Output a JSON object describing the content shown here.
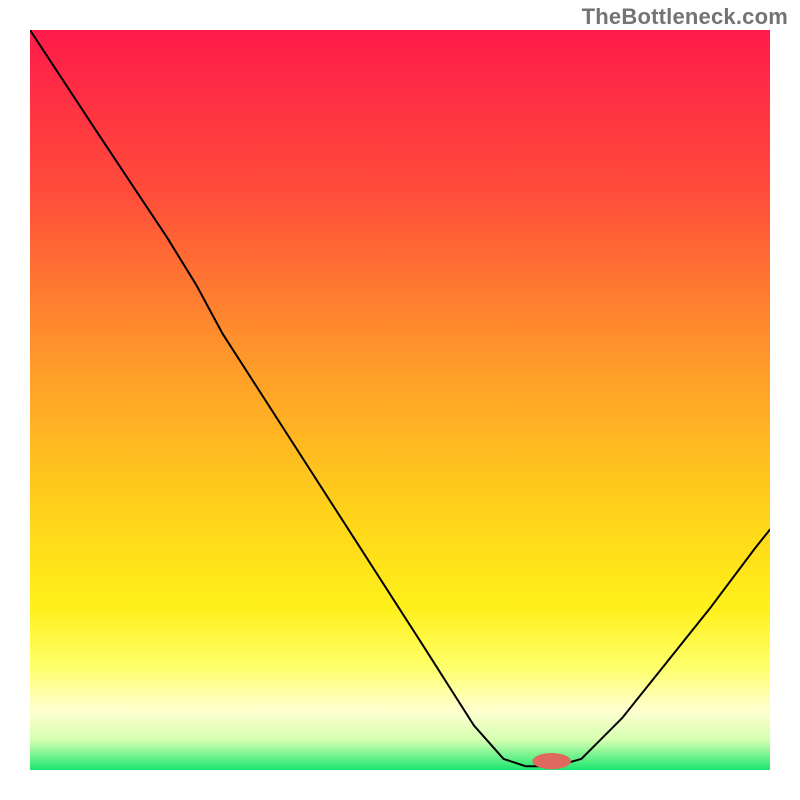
{
  "watermark": "TheBottleneck.com",
  "chart_data": {
    "type": "line",
    "title": "",
    "xlabel": "",
    "ylabel": "",
    "xlim": [
      0,
      100
    ],
    "ylim": [
      0,
      100
    ],
    "gradient_stops": [
      {
        "offset": 0,
        "color": "#ff1a4a"
      },
      {
        "offset": 22,
        "color": "#ff4d3a"
      },
      {
        "offset": 45,
        "color": "#ff9a2a"
      },
      {
        "offset": 65,
        "color": "#ffd21a"
      },
      {
        "offset": 78,
        "color": "#fff01a"
      },
      {
        "offset": 86,
        "color": "#ffff6a"
      },
      {
        "offset": 92,
        "color": "#ffffd0"
      },
      {
        "offset": 96,
        "color": "#d4ffb0"
      },
      {
        "offset": 100,
        "color": "#1ae66e"
      }
    ],
    "curve_points": [
      {
        "x": 0.0,
        "y": 100.0
      },
      {
        "x": 9.2,
        "y": 86.0
      },
      {
        "x": 18.5,
        "y": 72.0
      },
      {
        "x": 22.5,
        "y": 65.5
      },
      {
        "x": 26.0,
        "y": 59.0
      },
      {
        "x": 35.0,
        "y": 45.0
      },
      {
        "x": 44.0,
        "y": 31.0
      },
      {
        "x": 53.0,
        "y": 17.0
      },
      {
        "x": 60.0,
        "y": 6.0
      },
      {
        "x": 64.0,
        "y": 1.5
      },
      {
        "x": 67.0,
        "y": 0.5
      },
      {
        "x": 71.0,
        "y": 0.5
      },
      {
        "x": 74.5,
        "y": 1.5
      },
      {
        "x": 80.0,
        "y": 7.0
      },
      {
        "x": 86.0,
        "y": 14.5
      },
      {
        "x": 92.0,
        "y": 22.0
      },
      {
        "x": 98.0,
        "y": 30.0
      },
      {
        "x": 100.0,
        "y": 32.5
      }
    ],
    "marker": {
      "x": 70.5,
      "y": 1.2,
      "color": "#e0695f",
      "rx": 2.6,
      "ry": 1.1
    }
  }
}
